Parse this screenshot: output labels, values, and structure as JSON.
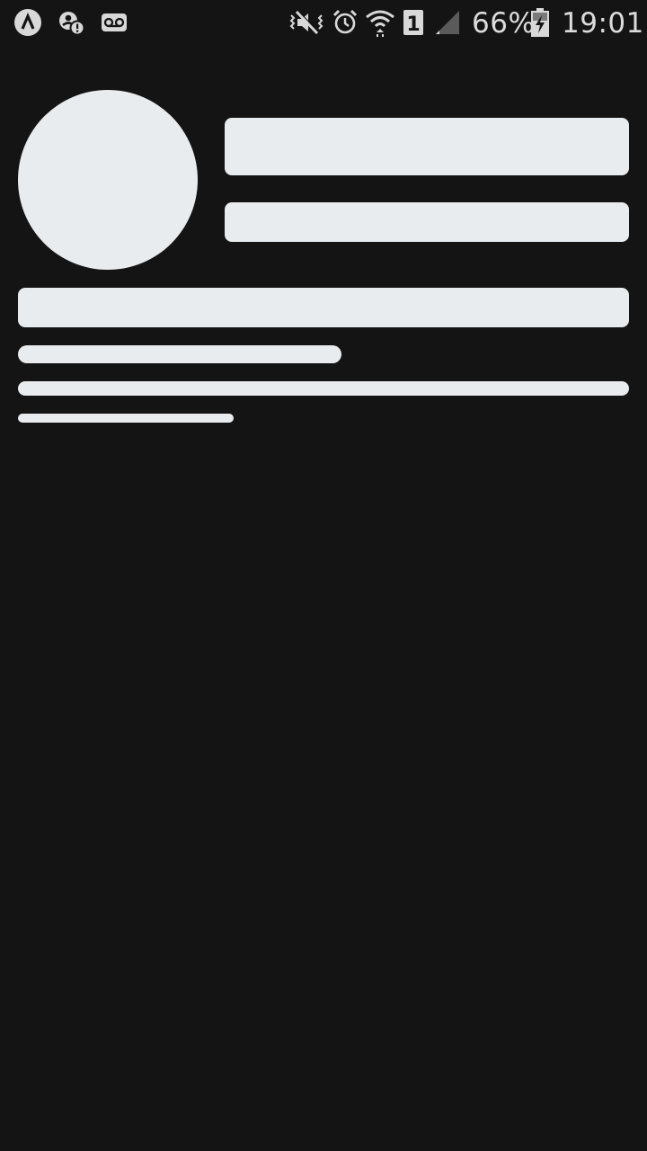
{
  "status_bar": {
    "battery_text": "66%",
    "time_text": "19:01",
    "sim_slot": "1",
    "icons": [
      "app-notification-icon",
      "account-alert-icon",
      "voicemail-icon",
      "vibrate-mute-icon",
      "alarm-icon",
      "wifi-icon",
      "sim-slot-icon",
      "cell-signal-icon",
      "battery-charging-icon"
    ]
  },
  "colors": {
    "background": "#141414",
    "skeleton": "#e9ecef",
    "status_text": "#dcdcdc"
  }
}
